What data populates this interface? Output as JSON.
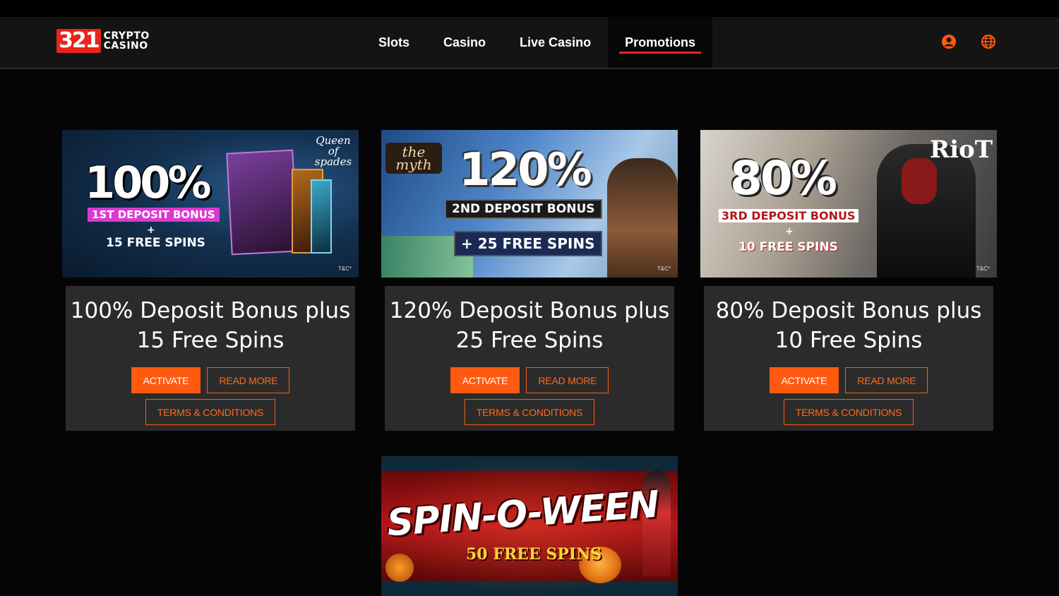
{
  "logo": {
    "number": "321",
    "line1": "CRYPTO",
    "line2": "CASINO"
  },
  "nav": [
    {
      "label": "Slots"
    },
    {
      "label": "Casino"
    },
    {
      "label": "Live Casino"
    },
    {
      "label": "Promotions",
      "active": true
    }
  ],
  "header_icons": {
    "account": "user-icon",
    "language": "globe-icon"
  },
  "colors": {
    "accent": "#ff5a0f",
    "brand_red": "#e8241c",
    "panel": "#2b2b2b",
    "background": "#050505"
  },
  "promos": [
    {
      "banner": {
        "percent": "100%",
        "bonus": "1ST DEPOSIT BONUS",
        "plus": "+",
        "spins": "15 FREE SPINS",
        "game": "Queen of spades",
        "tc": "T&C*"
      },
      "title_line1": "100% Deposit Bonus plus",
      "title_line2": "15 Free Spins",
      "activate": "ACTIVATE",
      "read_more": "READ MORE",
      "terms": "TERMS & CONDITIONS"
    },
    {
      "banner": {
        "percent": "120%",
        "bonus": "2ND DEPOSIT BONUS",
        "plus": "",
        "spins": "+ 25 FREE SPINS",
        "game": "the myth",
        "tc": "T&C*"
      },
      "title_line1": "120% Deposit Bonus plus",
      "title_line2": "25 Free Spins",
      "activate": "ACTIVATE",
      "read_more": "READ MORE",
      "terms": "TERMS & CONDITIONS"
    },
    {
      "banner": {
        "percent": "80%",
        "bonus": "3RD DEPOSIT BONUS",
        "plus": "+",
        "spins": "10 FREE SPINS",
        "game": "RioT",
        "tc": "T&C*"
      },
      "title_line1": "80% Deposit Bonus plus",
      "title_line2": "10 Free Spins",
      "activate": "ACTIVATE",
      "read_more": "READ MORE",
      "terms": "TERMS & CONDITIONS"
    }
  ],
  "spin_banner": {
    "title": "SPIN-O-WEEN",
    "spins": "50 FREE SPINS"
  }
}
